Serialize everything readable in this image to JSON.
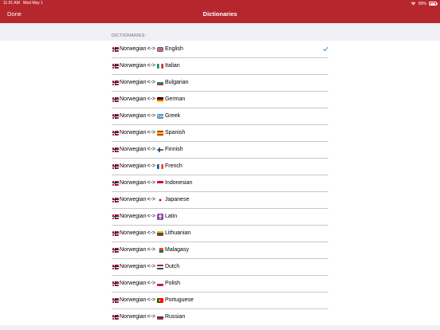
{
  "status_bar": {
    "time": "11:01 AM",
    "date": "Wed May 1",
    "battery": "80%"
  },
  "nav": {
    "done_label": "Done",
    "title": "Dictionaries"
  },
  "section": {
    "header": "DICTIONARIES:"
  },
  "accent_color": "#b5262d",
  "source_language": "Norwegian",
  "separator": "<->",
  "dictionaries": [
    {
      "target": "English",
      "flag": "gb-flag",
      "selected": true
    },
    {
      "target": "Italian",
      "flag": "it-flag",
      "selected": false
    },
    {
      "target": "Bulgarian",
      "flag": "bg-flag",
      "selected": false
    },
    {
      "target": "German",
      "flag": "de-flag",
      "selected": false
    },
    {
      "target": "Greek",
      "flag": "gr-flag",
      "selected": false
    },
    {
      "target": "Spanish",
      "flag": "es-flag",
      "selected": false
    },
    {
      "target": "Finnish",
      "flag": "fi-flag",
      "selected": false
    },
    {
      "target": "French",
      "flag": "fr-flag",
      "selected": false
    },
    {
      "target": "Indonesian",
      "flag": "id-flag",
      "selected": false
    },
    {
      "target": "Japanese",
      "flag": "jp-flag",
      "selected": false
    },
    {
      "target": "Latin",
      "flag": "latin-cross-icon",
      "selected": false
    },
    {
      "target": "Lithuanian",
      "flag": "lt-flag",
      "selected": false
    },
    {
      "target": "Malagasy",
      "flag": "mg-flag",
      "selected": false
    },
    {
      "target": "Dutch",
      "flag": "nl-flag",
      "selected": false
    },
    {
      "target": "Polish",
      "flag": "pl-flag",
      "selected": false
    },
    {
      "target": "Portuguese",
      "flag": "pt-flag",
      "selected": false
    },
    {
      "target": "Russian",
      "flag": "ru-flag",
      "selected": false
    }
  ]
}
